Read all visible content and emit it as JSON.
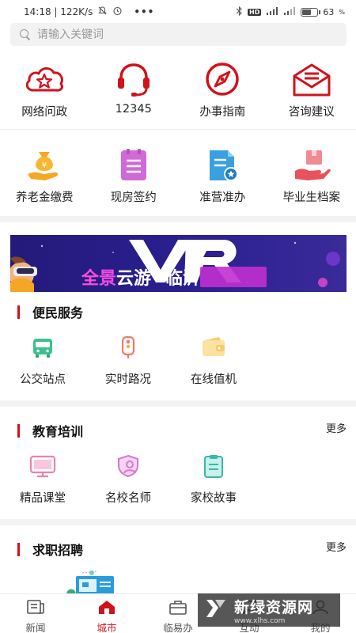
{
  "status_bar": {
    "time_speed": "14:18 | 122K/s",
    "dots": "•••",
    "hd": "HD",
    "battery_percent": "63",
    "battery_level": 0.63
  },
  "search": {
    "placeholder": "请输入关键词"
  },
  "top_services": [
    {
      "label": "网络问政",
      "icon": "cloud-star-icon"
    },
    {
      "label": "12345",
      "icon": "headset-icon"
    },
    {
      "label": "办事指南",
      "icon": "compass-icon"
    },
    {
      "label": "咨询建议",
      "icon": "mail-icon"
    }
  ],
  "second_services": [
    {
      "label": "养老金缴费",
      "icon": "money-bag-icon"
    },
    {
      "label": "现房签约",
      "icon": "document-list-icon"
    },
    {
      "label": "准营准办",
      "icon": "certificate-icon"
    },
    {
      "label": "毕业生档案",
      "icon": "hand-box-icon"
    }
  ],
  "banner": {
    "brand": "VR",
    "text": "全景云游临沂"
  },
  "sections": {
    "convenience": {
      "title": "便民服务",
      "items": [
        {
          "label": "公交站点",
          "icon": "bus-icon"
        },
        {
          "label": "实时路况",
          "icon": "traffic-light-icon"
        },
        {
          "label": "在线值机",
          "icon": "wallet-icon"
        }
      ]
    },
    "education": {
      "title": "教育培训",
      "more": "更多",
      "items": [
        {
          "label": "精品课堂",
          "icon": "monitor-icon"
        },
        {
          "label": "名校名师",
          "icon": "shield-person-icon"
        },
        {
          "label": "家校故事",
          "icon": "clipboard-icon"
        }
      ]
    },
    "jobs": {
      "title": "求职招聘",
      "more": "更多"
    }
  },
  "bottom_nav": [
    {
      "label": "新闻",
      "icon": "news-icon",
      "active": false
    },
    {
      "label": "城市",
      "icon": "home-icon",
      "active": true
    },
    {
      "label": "临易办",
      "icon": "briefcase-icon",
      "active": false
    },
    {
      "label": "互动",
      "icon": "chat-icon",
      "active": false
    },
    {
      "label": "我的",
      "icon": "user-icon",
      "active": false
    }
  ],
  "watermark": {
    "main": "新绿资源网",
    "sub": "www.xlhs.com"
  },
  "colors": {
    "accent": "#d0121b",
    "divider": "#f3f3f3"
  }
}
